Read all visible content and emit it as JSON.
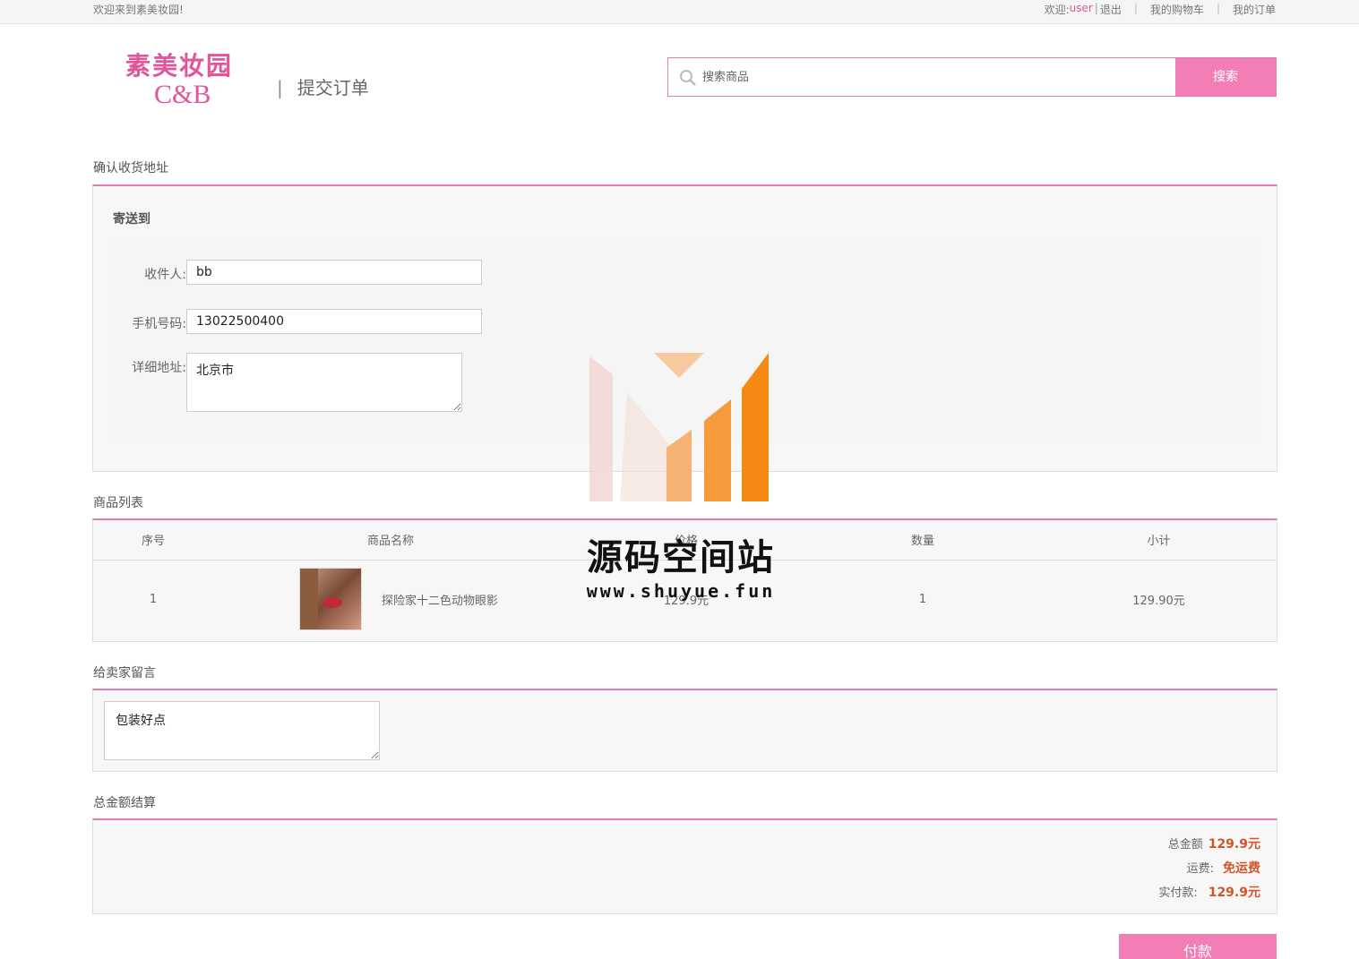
{
  "topbar": {
    "welcome": "欢迎来到素美妆园!",
    "welcome_prefix": "欢迎:",
    "user": "user",
    "pipe": "|",
    "logout": "退出",
    "sep": "|",
    "cart": "我的购物车",
    "orders": "我的订单"
  },
  "logo": {
    "cn": "素美妆园",
    "en": "C&B"
  },
  "header": {
    "bar": "|",
    "title": "提交订单"
  },
  "search": {
    "placeholder": "搜索商品",
    "button": "搜索"
  },
  "address": {
    "section_title": "确认收货地址",
    "ship_to": "寄送到",
    "receiver_label": "收件人:",
    "receiver_value": "bb",
    "phone_label": "手机号码:",
    "phone_value": "13022500400",
    "detail_label": "详细地址:",
    "detail_value": "北京市"
  },
  "goods": {
    "section_title": "商品列表",
    "headers": [
      "序号",
      "商品名称",
      "价格",
      "数量",
      "小计"
    ],
    "rows": [
      {
        "index": "1",
        "name": "探险家十二色动物眼影",
        "price": "129.9元",
        "qty": "1",
        "subtotal": "129.90元"
      }
    ]
  },
  "message": {
    "section_title": "给卖家留言",
    "value": "包装好点"
  },
  "summary": {
    "section_title": "总金额结算",
    "total_label": "总金额",
    "total_value": "129.9元",
    "shipping_label": "运费:",
    "shipping_value": "免运费",
    "paid_label": "实付款:",
    "paid_value": "129.9元"
  },
  "pay_button": "付款",
  "watermark": {
    "text": "源码空间站",
    "url": "www.shuyue.fun"
  },
  "colors": {
    "accent": "#f27eb5",
    "border_accent": "#e27cb0",
    "price": "#d2562a"
  }
}
